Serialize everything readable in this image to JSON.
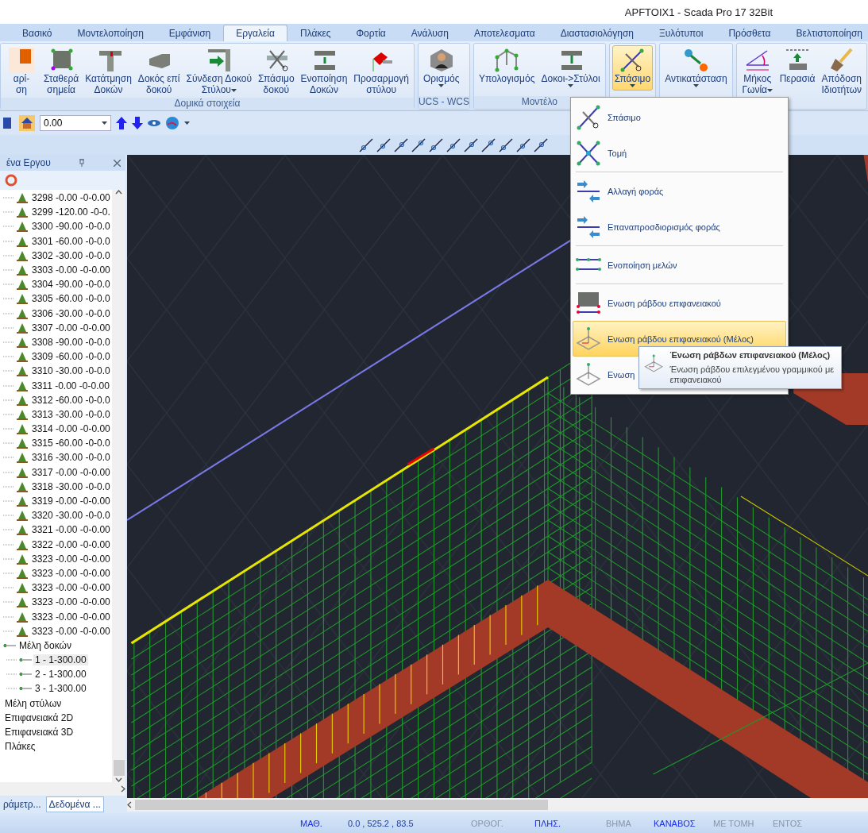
{
  "window": {
    "title": "APFTOIX1 - Scada Pro 17 32Bit"
  },
  "ribbon": {
    "tabs": [
      {
        "label": "Βασικό",
        "selected": false
      },
      {
        "label": "Μοντελοποίηση",
        "selected": false
      },
      {
        "label": "Εμφάνιση",
        "selected": false
      },
      {
        "label": "Εργαλεία",
        "selected": true
      },
      {
        "label": "Πλάκες",
        "selected": false
      },
      {
        "label": "Φορτία",
        "selected": false
      },
      {
        "label": "Ανάλυση",
        "selected": false
      },
      {
        "label": "Αποτελεσματα",
        "selected": false
      },
      {
        "label": "Διαστασιολόγηση",
        "selected": false
      },
      {
        "label": "Ξυλότυποι",
        "selected": false
      },
      {
        "label": "Πρόσθετα",
        "selected": false
      },
      {
        "label": "Βελτιστοποίηση",
        "selected": false
      }
    ],
    "groups": [
      {
        "label": "Δομικά στοιχεία",
        "buttons": [
          {
            "lines": [
              "αρί-",
              "ση"
            ],
            "dropdown": false,
            "pressed": false
          },
          {
            "lines": [
              "Σταθερά",
              "σημεία"
            ],
            "dropdown": false,
            "pressed": false
          },
          {
            "lines": [
              "Κατάτμηση",
              "Δοκών"
            ],
            "dropdown": false,
            "pressed": false
          },
          {
            "lines": [
              "Δοκός επί",
              "δοκού"
            ],
            "dropdown": false,
            "pressed": false
          },
          {
            "lines": [
              "Σύνδεση Δοκού",
              "Στύλου"
            ],
            "dropdown": true,
            "pressed": false
          },
          {
            "lines": [
              "Σπάσιμο",
              "δοκού"
            ],
            "dropdown": false,
            "pressed": false
          },
          {
            "lines": [
              "Ενοποίηση",
              "Δοκών"
            ],
            "dropdown": false,
            "pressed": false
          },
          {
            "lines": [
              "Προσαρμογή",
              "στύλου"
            ],
            "dropdown": false,
            "pressed": false
          }
        ]
      },
      {
        "label": "UCS - WCS",
        "buttons": [
          {
            "lines": [
              "Ορισμός"
            ],
            "dropdown": true,
            "pressed": false
          }
        ]
      },
      {
        "label": "Μοντέλο",
        "buttons": [
          {
            "lines": [
              "Υπολογισμός"
            ],
            "dropdown": false,
            "pressed": false
          },
          {
            "lines": [
              "Δοκοι->Στύλοι"
            ],
            "dropdown": true,
            "pressed": false
          }
        ]
      },
      {
        "buttons": [
          {
            "lines": [
              "Σπάσιμο"
            ],
            "dropdown": true,
            "pressed": true
          }
        ]
      },
      {
        "buttons": [
          {
            "lines": [
              "Αντικατάσταση"
            ],
            "dropdown": true,
            "pressed": false
          }
        ]
      },
      {
        "buttons": [
          {
            "lines": [
              "Μήκος",
              "Γωνία"
            ],
            "dropdown": true,
            "pressed": false
          },
          {
            "lines": [
              "Περασιά"
            ],
            "dropdown": false,
            "pressed": false
          },
          {
            "lines": [
              "Απόδοση",
              "Ιδιοτήτων"
            ],
            "dropdown": false,
            "pressed": false
          }
        ]
      }
    ]
  },
  "quick_toolbar": {
    "level_field": {
      "value": "0.00"
    }
  },
  "panel": {
    "title": "ένα Εργου",
    "orphan_rows": [
      "3298 -0.00 -0-0.00",
      "3299 -120.00 -0-0.",
      "3300 -90.00 -0-0.0",
      "3301 -60.00 -0-0.0",
      "3302 -30.00 -0-0.0",
      "3303 -0.00 -0-0.00",
      "3304 -90.00 -0-0.0",
      "3305 -60.00 -0-0.0",
      "3306 -30.00 -0-0.0",
      "3307 -0.00 -0-0.00",
      "3308 -90.00 -0-0.0",
      "3309 -60.00 -0-0.0",
      "3310 -30.00 -0-0.0",
      "3311 -0.00 -0-0.00",
      "3312 -60.00 -0-0.0",
      "3313 -30.00 -0-0.0",
      "3314 -0.00 -0-0.00",
      "3315 -60.00 -0-0.0",
      "3316 -30.00 -0-0.0",
      "3317 -0.00 -0-0.00",
      "3318 -30.00 -0-0.0",
      "3319 -0.00 -0-0.00",
      "3320 -30.00 -0-0.0",
      "3321 -0.00 -0-0.00",
      "3322 -0.00 -0-0.00",
      "3323 -0.00 -0-0.00",
      "3323 -0.00 -0-0.00",
      "3323 -0.00 -0-0.00",
      "3323 -0.00 -0-0.00",
      "3323 -0.00 -0-0.00",
      "3323 -0.00 -0-0.00"
    ],
    "items": [
      {
        "label": "Μέλη δοκών",
        "selected": false,
        "children": [
          {
            "label": "1 - 1-300.00",
            "selected": true
          },
          {
            "label": "2 - 1-300.00",
            "selected": false
          },
          {
            "label": "3 - 1-300.00",
            "selected": false
          }
        ]
      },
      {
        "label": "Μέλη στύλων",
        "selected": false
      },
      {
        "label": "Επιφανειακά 2D",
        "selected": false
      },
      {
        "label": "Επιφανειακά 3D",
        "selected": false
      },
      {
        "label": "Πλάκες",
        "selected": false
      }
    ],
    "tabs": [
      {
        "label": "ράμετρ...",
        "selected": false
      },
      {
        "label": "Δεδομένα ...",
        "selected": true
      }
    ]
  },
  "menu": {
    "items": [
      {
        "label": "Σπάσιμο",
        "separator_before": false,
        "selected": false
      },
      {
        "label": "Τομή",
        "separator_before": false,
        "selected": false
      },
      {
        "label": "Αλλαγή φοράς",
        "separator_before": true,
        "selected": false
      },
      {
        "label": "Επαναπροσδιορισμός φοράς",
        "separator_before": false,
        "selected": false
      },
      {
        "label": "Ενοποίηση μελών",
        "separator_before": true,
        "selected": false
      },
      {
        "label": "Ενωση ράβδου επιφανειακού",
        "separator_before": true,
        "selected": false
      },
      {
        "label": "Ενωση ράβδου επιφανειακού (Μέλος)",
        "separator_before": false,
        "selected": true
      },
      {
        "label": "Ενωση",
        "separator_before": false,
        "selected": false
      }
    ]
  },
  "tooltip": {
    "title": "Ένωση ράβδων επιφανειακού (Μέλος)",
    "body": "Ένωση ράβδου επιλεγμένου γραμμικού με επιφανειακού"
  },
  "status_bar": [
    {
      "kind": "toggle",
      "text": "ΜΑΘ.",
      "on": true
    },
    {
      "kind": "readout",
      "text": "0.0 , 525.2 , 83.5"
    },
    {
      "kind": "toggle",
      "text": "ΟΡΘΟΓ.",
      "on": false
    },
    {
      "kind": "toggle",
      "text": "ΠΛΗΣ.",
      "on": true
    },
    {
      "kind": "toggle",
      "text": "ΒΗΜΑ",
      "on": false
    },
    {
      "kind": "toggle",
      "text": "ΚΑΝΑΒΟΣ",
      "on": true
    },
    {
      "kind": "toggle",
      "text": "ΜΕ ΤΟΜΗ",
      "on": false
    },
    {
      "kind": "toggle",
      "text": "ΕΝΤΟΣ",
      "on": false
    }
  ]
}
